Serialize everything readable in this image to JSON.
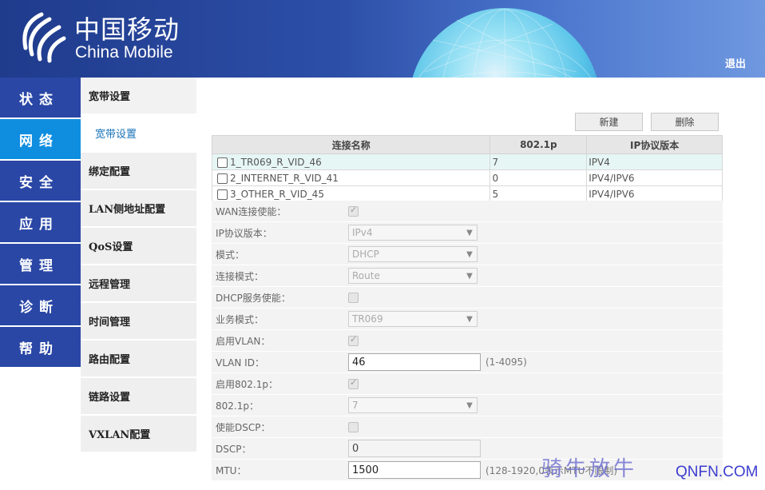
{
  "header": {
    "logo_cn": "中国移动",
    "logo_en": "China Mobile",
    "logout": "退出"
  },
  "main_nav": [
    {
      "label": "状态",
      "active": false
    },
    {
      "label": "网络",
      "active": true
    },
    {
      "label": "安全",
      "active": false
    },
    {
      "label": "应用",
      "active": false
    },
    {
      "label": "管理",
      "active": false
    },
    {
      "label": "诊断",
      "active": false
    },
    {
      "label": "帮助",
      "active": false
    }
  ],
  "sub_nav": [
    {
      "label": "宽带设置",
      "group": true
    },
    {
      "label": "宽带设置",
      "active": true
    },
    {
      "label": "绑定配置"
    },
    {
      "label": "LAN侧地址配置"
    },
    {
      "label": "QoS设置"
    },
    {
      "label": "远程管理"
    },
    {
      "label": "时间管理"
    },
    {
      "label": "路由配置"
    },
    {
      "label": "链路设置"
    },
    {
      "label": "VXLAN配置"
    }
  ],
  "toolbar": {
    "new_label": "新建",
    "delete_label": "删除"
  },
  "table": {
    "headers": [
      "连接名称",
      "802.1p",
      "IP协议版本"
    ],
    "rows": [
      {
        "name": "1_TR069_R_VID_46",
        "p8021": "7",
        "ip": "IPV4"
      },
      {
        "name": "2_INTERNET_R_VID_41",
        "p8021": "0",
        "ip": "IPV4/IPV6"
      },
      {
        "name": "3_OTHER_R_VID_45",
        "p8021": "5",
        "ip": "IPV4/IPV6"
      }
    ]
  },
  "form": {
    "wan_enable": {
      "label": "WAN连接使能：",
      "checked": true
    },
    "ip_version": {
      "label": "IP协议版本：",
      "value": "IPv4"
    },
    "mode": {
      "label": "模式：",
      "value": "DHCP"
    },
    "conn_mode": {
      "label": "连接模式：",
      "value": "Route"
    },
    "dhcp_server": {
      "label": "DHCP服务使能：",
      "checked": false
    },
    "service_mode": {
      "label": "业务模式：",
      "value": "TR069"
    },
    "vlan_enable": {
      "label": "启用VLAN：",
      "checked": true
    },
    "vlan_id": {
      "label": "VLAN ID：",
      "value": "46",
      "hint": "(1-4095)"
    },
    "p8021_enable": {
      "label": "启用802.1p：",
      "checked": true
    },
    "p8021": {
      "label": "802.1p：",
      "value": "7"
    },
    "dscp_enable": {
      "label": "使能DSCP：",
      "checked": false
    },
    "dscp": {
      "label": "DSCP：",
      "value": "0"
    },
    "mtu": {
      "label": "MTU：",
      "value": "1500",
      "hint": "(128-1920,0表示MTU不限制)"
    }
  },
  "watermark": {
    "cn": "骑牛放牛",
    "en": "QNFN.COM"
  },
  "colors": {
    "nav_blue": "#2a47a6",
    "nav_active": "#0f8ee0",
    "header": "#1f3b8c"
  }
}
